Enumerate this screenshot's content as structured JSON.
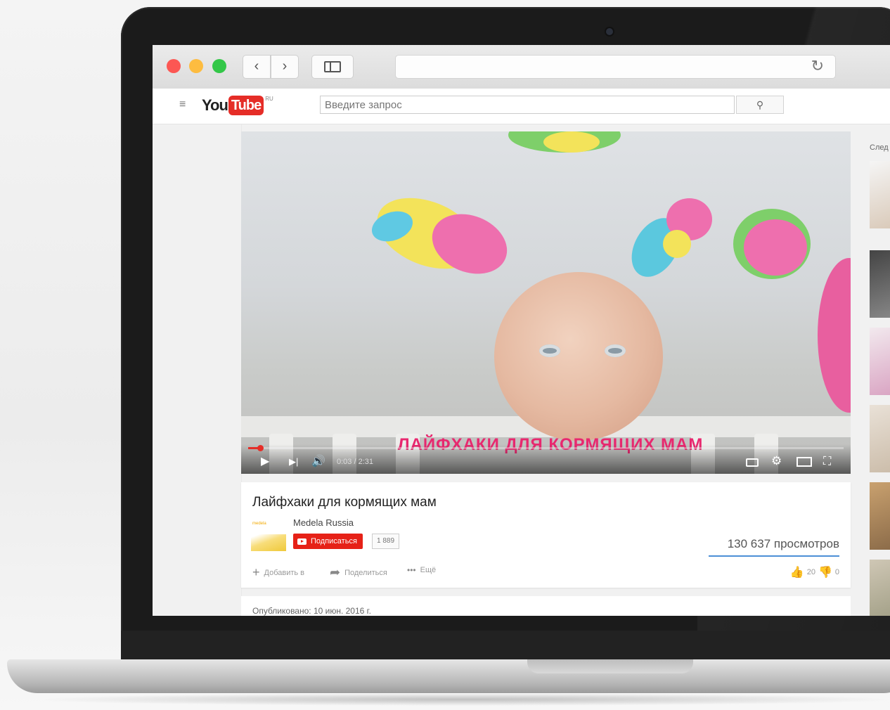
{
  "browser": {
    "back_glyph": "‹",
    "forward_glyph": "›",
    "reload_glyph": "↻",
    "window_controls": {
      "close": "#fc5753",
      "minimize": "#fdbc40",
      "maximize": "#33c748"
    }
  },
  "youtube": {
    "logo_you": "You",
    "logo_tube": "Tube",
    "logo_region": "RU",
    "guide_glyph": "≡",
    "search_placeholder": "Введите запрос",
    "search_glyph": "⚲",
    "brand_color": "#e52d27"
  },
  "player": {
    "overlay_title": "ЛАЙФХАКИ ДЛЯ КОРМЯЩИХ МАМ",
    "time": "0:03 / 2:31",
    "progress_fraction": 0.02,
    "play_glyph": "▶",
    "next_glyph": "▶|",
    "volume_glyph": "🔊",
    "settings_glyph": "⚙",
    "fullscreen_glyph": "⛶",
    "icons": [
      "play-icon",
      "next-icon",
      "volume-icon",
      "captions-icon",
      "settings-icon",
      "theater-icon",
      "fullscreen-icon"
    ]
  },
  "video": {
    "title": "Лайфхаки для кормящих мам",
    "channel_logo_text": "medela",
    "channel_name": "Medela Russia",
    "subscribe_label": "Подписаться",
    "subscriber_count": "1 889",
    "views": "130 637 просмотров",
    "actions": {
      "add_to": "Добавить в",
      "share": "Поделиться",
      "more": "Ещё",
      "likes": "20",
      "dislikes": "0"
    },
    "published": "Опубликовано: 10 июн. 2016 г."
  },
  "sidebar": {
    "up_next_label": "След"
  }
}
